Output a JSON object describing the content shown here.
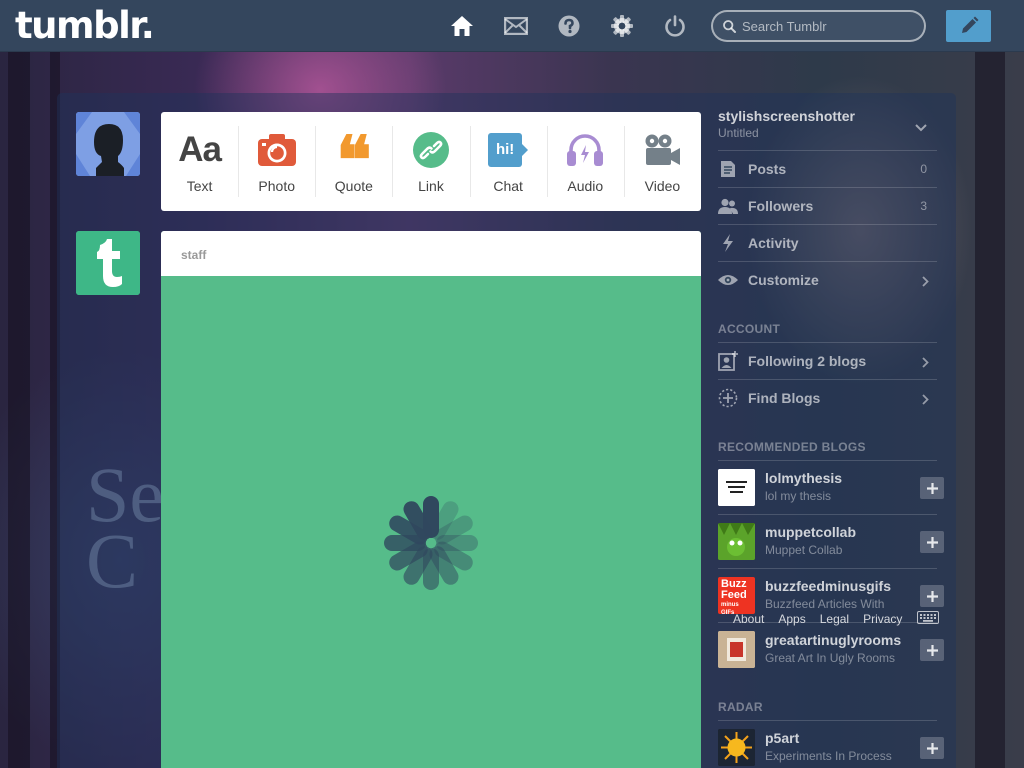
{
  "header": {
    "logo": "tumblr.",
    "search_placeholder": "Search Tumblr"
  },
  "post_types": [
    {
      "label": "Text",
      "icon_glyph": "Aa"
    },
    {
      "label": "Photo"
    },
    {
      "label": "Quote",
      "icon_glyph": "❝"
    },
    {
      "label": "Link"
    },
    {
      "label": "Chat",
      "icon_glyph": "hi!"
    },
    {
      "label": "Audio"
    },
    {
      "label": "Video"
    }
  ],
  "feed": {
    "post_blog": "staff"
  },
  "sidebar": {
    "blog_name": "stylishscreenshotter",
    "blog_title": "Untitled",
    "menu": {
      "posts": {
        "label": "Posts",
        "count": "0"
      },
      "followers": {
        "label": "Followers",
        "count": "3"
      },
      "activity": {
        "label": "Activity"
      },
      "customize": {
        "label": "Customize"
      }
    },
    "account_heading": "ACCOUNT",
    "account": {
      "following": "Following 2 blogs",
      "find_blogs": "Find Blogs"
    },
    "recommended_heading": "RECOMMENDED BLOGS",
    "recommended": [
      {
        "name": "lolmythesis",
        "title": "lol my thesis"
      },
      {
        "name": "muppetcollab",
        "title": "Muppet Collab"
      },
      {
        "name": "buzzfeedminusgifs",
        "title": "Buzzfeed Articles With",
        "thumb_text": [
          "Buzz",
          "Feed",
          "minus GIFs"
        ]
      },
      {
        "name": "greatartinuglyrooms",
        "title": "Great Art In Ugly Rooms"
      }
    ],
    "radar_heading": "RADAR",
    "radar": {
      "name": "p5art",
      "title": "Experiments In Process"
    }
  },
  "footer": {
    "links": [
      "About",
      "Apps",
      "Legal",
      "Privacy"
    ]
  },
  "background": {
    "title": "Se\nC"
  },
  "colors": {
    "header_bg": "#34465d",
    "compose": "#529ecc",
    "staff_card": "#56bc8a",
    "photo_icon": "#e05a3a",
    "quote_icon": "#f2992e",
    "link_icon": "#56bc8a",
    "chat_icon": "#529ecc",
    "audio_icon": "#a88cd2",
    "video_icon": "#748089"
  }
}
